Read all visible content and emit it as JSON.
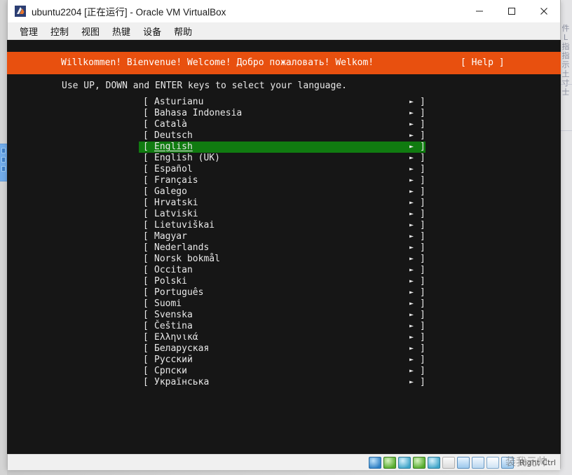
{
  "window": {
    "title": "ubuntu2204 [正在运行] - Oracle VM VirtualBox",
    "app_icon": "virtualbox-icon",
    "controls": {
      "minimize": "—",
      "maximize": "□",
      "close": "✕"
    }
  },
  "menubar": {
    "items": [
      {
        "label": "管理"
      },
      {
        "label": "控制"
      },
      {
        "label": "视图"
      },
      {
        "label": "热键"
      },
      {
        "label": "设备"
      },
      {
        "label": "帮助"
      }
    ]
  },
  "installer": {
    "banner_text": "Willkommen! Bienvenue! Welcome! Добро пожаловать! Welkom!",
    "help_button": "[ Help ]",
    "instruction": "Use UP, DOWN and ENTER keys to select your language.",
    "bracket_open": "[",
    "bracket_close": "]",
    "arrow_glyph": "►",
    "selected_index": 4,
    "languages": [
      {
        "label": "Asturianu"
      },
      {
        "label": "Bahasa Indonesia"
      },
      {
        "label": "Català"
      },
      {
        "label": "Deutsch"
      },
      {
        "label": "English"
      },
      {
        "label": "English (UK)"
      },
      {
        "label": "Español"
      },
      {
        "label": "Français"
      },
      {
        "label": "Galego"
      },
      {
        "label": "Hrvatski"
      },
      {
        "label": "Latviski"
      },
      {
        "label": "Lietuviškai"
      },
      {
        "label": "Magyar"
      },
      {
        "label": "Nederlands"
      },
      {
        "label": "Norsk bokmål"
      },
      {
        "label": "Occitan"
      },
      {
        "label": "Polski"
      },
      {
        "label": "Português"
      },
      {
        "label": "Suomi"
      },
      {
        "label": "Svenska"
      },
      {
        "label": "Čeština"
      },
      {
        "label": "Ελληνικά"
      },
      {
        "label": "Беларуская"
      },
      {
        "label": "Русский"
      },
      {
        "label": "Српски"
      },
      {
        "label": "Українська"
      }
    ]
  },
  "statusbar": {
    "host_key_label": "Right Ctrl",
    "overlay_text": "装我元帅",
    "icons": [
      {
        "name": "hard-disk-icon"
      },
      {
        "name": "optical-disk-icon"
      },
      {
        "name": "floppy-disk-icon"
      },
      {
        "name": "network-icon"
      },
      {
        "name": "usb-icon"
      },
      {
        "name": "shared-folders-icon"
      },
      {
        "name": "display-icon"
      },
      {
        "name": "recording-icon"
      },
      {
        "name": "mouse-integration-icon"
      },
      {
        "name": "keyboard-icon"
      }
    ]
  },
  "colors": {
    "banner_orange": "#e8500f",
    "selection_green": "#107b10",
    "terminal_bg": "#161616",
    "terminal_fg": "#e8e8e8"
  },
  "background": {
    "right_column_text": "件 L 指 指 示 土 寸 士"
  }
}
